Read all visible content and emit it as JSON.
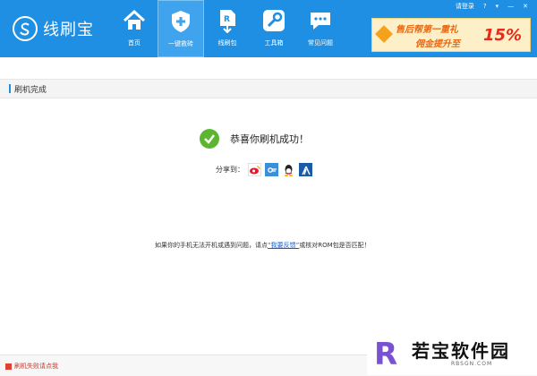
{
  "app": {
    "name": "线刷宝"
  },
  "top_links": {
    "login": "请登录",
    "help": "?"
  },
  "nav": {
    "items": [
      {
        "label": "首页",
        "icon": "home-icon"
      },
      {
        "label": "一键救砖",
        "icon": "shield-plus-icon"
      },
      {
        "label": "线刷包",
        "icon": "rom-package-icon"
      },
      {
        "label": "工具箱",
        "icon": "wrench-icon"
      },
      {
        "label": "常见问题",
        "icon": "chat-bubble-icon"
      }
    ],
    "active_index": 1
  },
  "banner": {
    "line1": "售后帮第一重礼",
    "line2": "佣金提升至",
    "percent": "15%"
  },
  "section": {
    "title": "刷机完成"
  },
  "result": {
    "message": "恭喜你刷机成功！"
  },
  "share": {
    "label": "分享到：",
    "targets": [
      "weibo-icon",
      "tencent-weibo-icon",
      "qq-icon",
      "renren-icon"
    ]
  },
  "help": {
    "prefix": "如果你的手机无法开机或遇到问题，请点",
    "link": "“我要反馈”",
    "suffix": "或核对ROM包是否匹配！"
  },
  "footer": {
    "error_link": "刷机失败请点我"
  },
  "watermark": {
    "brand": "若宝软件园",
    "url": "RBSGN.COM"
  },
  "colors": {
    "accent": "#1e8fe3",
    "success": "#5cb531",
    "link": "#1a5fc9",
    "error": "#c43a2d"
  }
}
